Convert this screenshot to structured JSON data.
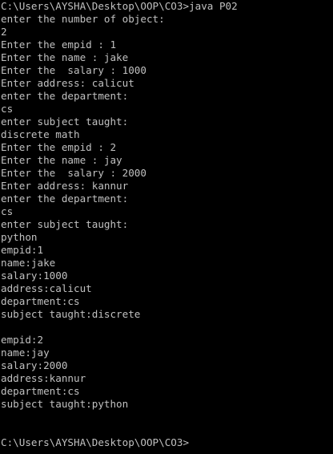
{
  "console": {
    "colors": {
      "background": "#000000",
      "text": "#c0c0c0"
    },
    "lines": [
      "C:\\Users\\AYSHA\\Desktop\\OOP\\CO3>java P02",
      "enter the number of object:",
      "2",
      "Enter the empid : 1",
      "Enter the name : jake",
      "Enter the  salary : 1000",
      "Enter address: calicut",
      "enter the department:",
      "cs",
      "enter subject taught:",
      "discrete math",
      "Enter the empid : 2",
      "Enter the name : jay",
      "Enter the  salary : 2000",
      "Enter address: kannur",
      "enter the department:",
      "cs",
      "enter subject taught:",
      "python",
      "empid:1",
      "name:jake",
      "salary:1000",
      "address:calicut",
      "department:cs",
      "subject taught:discrete",
      "",
      "empid:2",
      "name:jay",
      "salary:2000",
      "address:kannur",
      "department:cs",
      "subject taught:python",
      "",
      "",
      "C:\\Users\\AYSHA\\Desktop\\OOP\\CO3>"
    ]
  }
}
